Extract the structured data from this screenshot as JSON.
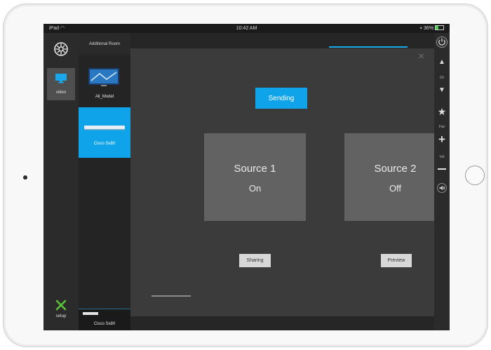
{
  "status_bar": {
    "device": "iPad",
    "wifi_icon": "wifi-icon",
    "time": "10:42 AM",
    "battery": "36%"
  },
  "left_nav": {
    "video_label": "video",
    "setup_label": "setup"
  },
  "room_list": {
    "title": "Additional Room",
    "items": [
      {
        "label": "All_Model",
        "selected": false
      },
      {
        "label": "Cisco Sx80",
        "selected": true
      }
    ],
    "bottom_item": "Cisco Sx80"
  },
  "main": {
    "sending_button": "Sending",
    "sources": [
      {
        "name": "Source 1",
        "state": "On"
      },
      {
        "name": "Source 2",
        "state": "Off"
      }
    ],
    "sharing_button": "Sharing",
    "preview_button": "Preview"
  },
  "right_bar": {
    "ch_label": "Ch",
    "fav_label": "Fav",
    "vol_label": "Vol"
  },
  "colors": {
    "accent": "#0fa4ea",
    "background": "#3b3b3b"
  }
}
